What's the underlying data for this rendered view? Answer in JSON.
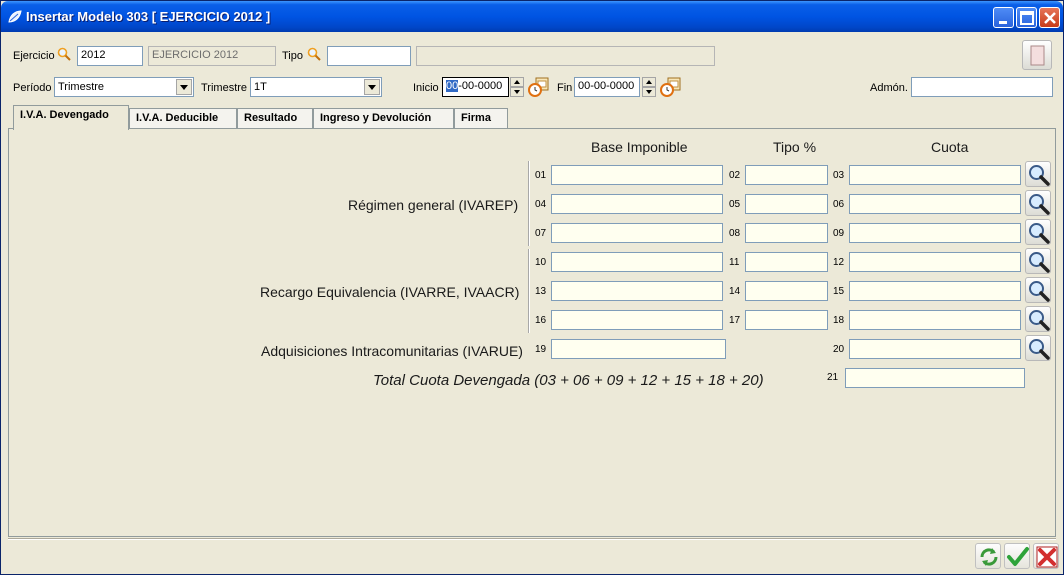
{
  "window": {
    "title": "Insertar Modelo 303 [ EJERCICIO 2012 ]"
  },
  "header": {
    "ejercicio_label": "Ejercicio",
    "ejercicio_value": "2012",
    "ejercicio_desc": "EJERCICIO 2012",
    "tipo_label": "Tipo",
    "tipo_value": "",
    "tipo_desc": "",
    "periodo_label": "Período",
    "periodo_value": "Trimestre",
    "trimestre_label": "Trimestre",
    "trimestre_value": "1T",
    "inicio_label": "Inicio",
    "inicio_sel": "00",
    "inicio_rest": "-00-0000",
    "fin_label": "Fin",
    "fin_value": "00-00-0000",
    "admon_label": "Admón.",
    "admon_value": ""
  },
  "tabs": [
    {
      "label": "I.V.A. Devengado",
      "active": true
    },
    {
      "label": "I.V.A. Deducible",
      "active": false
    },
    {
      "label": "Resultado",
      "active": false
    },
    {
      "label": "Ingreso y Devolución",
      "active": false
    },
    {
      "label": "Firma",
      "active": false
    }
  ],
  "columns": {
    "base": "Base Imponible",
    "tipo": "Tipo %",
    "cuota": "Cuota"
  },
  "sections": {
    "regimen_general": "Régimen general (IVAREP)",
    "recargo": "Recargo Equivalencia (IVARRE, IVAACR)",
    "adquisiciones": "Adquisiciones Intracomunitarias (IVARUE)"
  },
  "box_numbers": [
    "01",
    "02",
    "03",
    "04",
    "05",
    "06",
    "07",
    "08",
    "09",
    "10",
    "11",
    "12",
    "13",
    "14",
    "15",
    "16",
    "17",
    "18",
    "19",
    "20",
    "21"
  ],
  "box_values": {
    "01": "",
    "02": "",
    "03": "",
    "04": "",
    "05": "",
    "06": "",
    "07": "",
    "08": "",
    "09": "",
    "10": "",
    "11": "",
    "12": "",
    "13": "",
    "14": "",
    "15": "",
    "16": "",
    "17": "",
    "18": "",
    "19": "",
    "20": "",
    "21": ""
  },
  "total_label": "Total Cuota Devengada (03 + 06 + 09 + 12 + 15 + 18 + 20)",
  "icons": {
    "app": "app-leaf-icon",
    "lookup": "magnifier-icon",
    "calendar": "calendar-icon",
    "refresh": "refresh-icon",
    "accept": "checkmark-icon",
    "cancel": "cancel-x-icon"
  },
  "colors": {
    "titlebar": "#0054e3",
    "window_bg": "#ece9d8",
    "field_bg": "#fffff0",
    "accept": "#2ea33a",
    "cancel": "#d32f2f"
  }
}
